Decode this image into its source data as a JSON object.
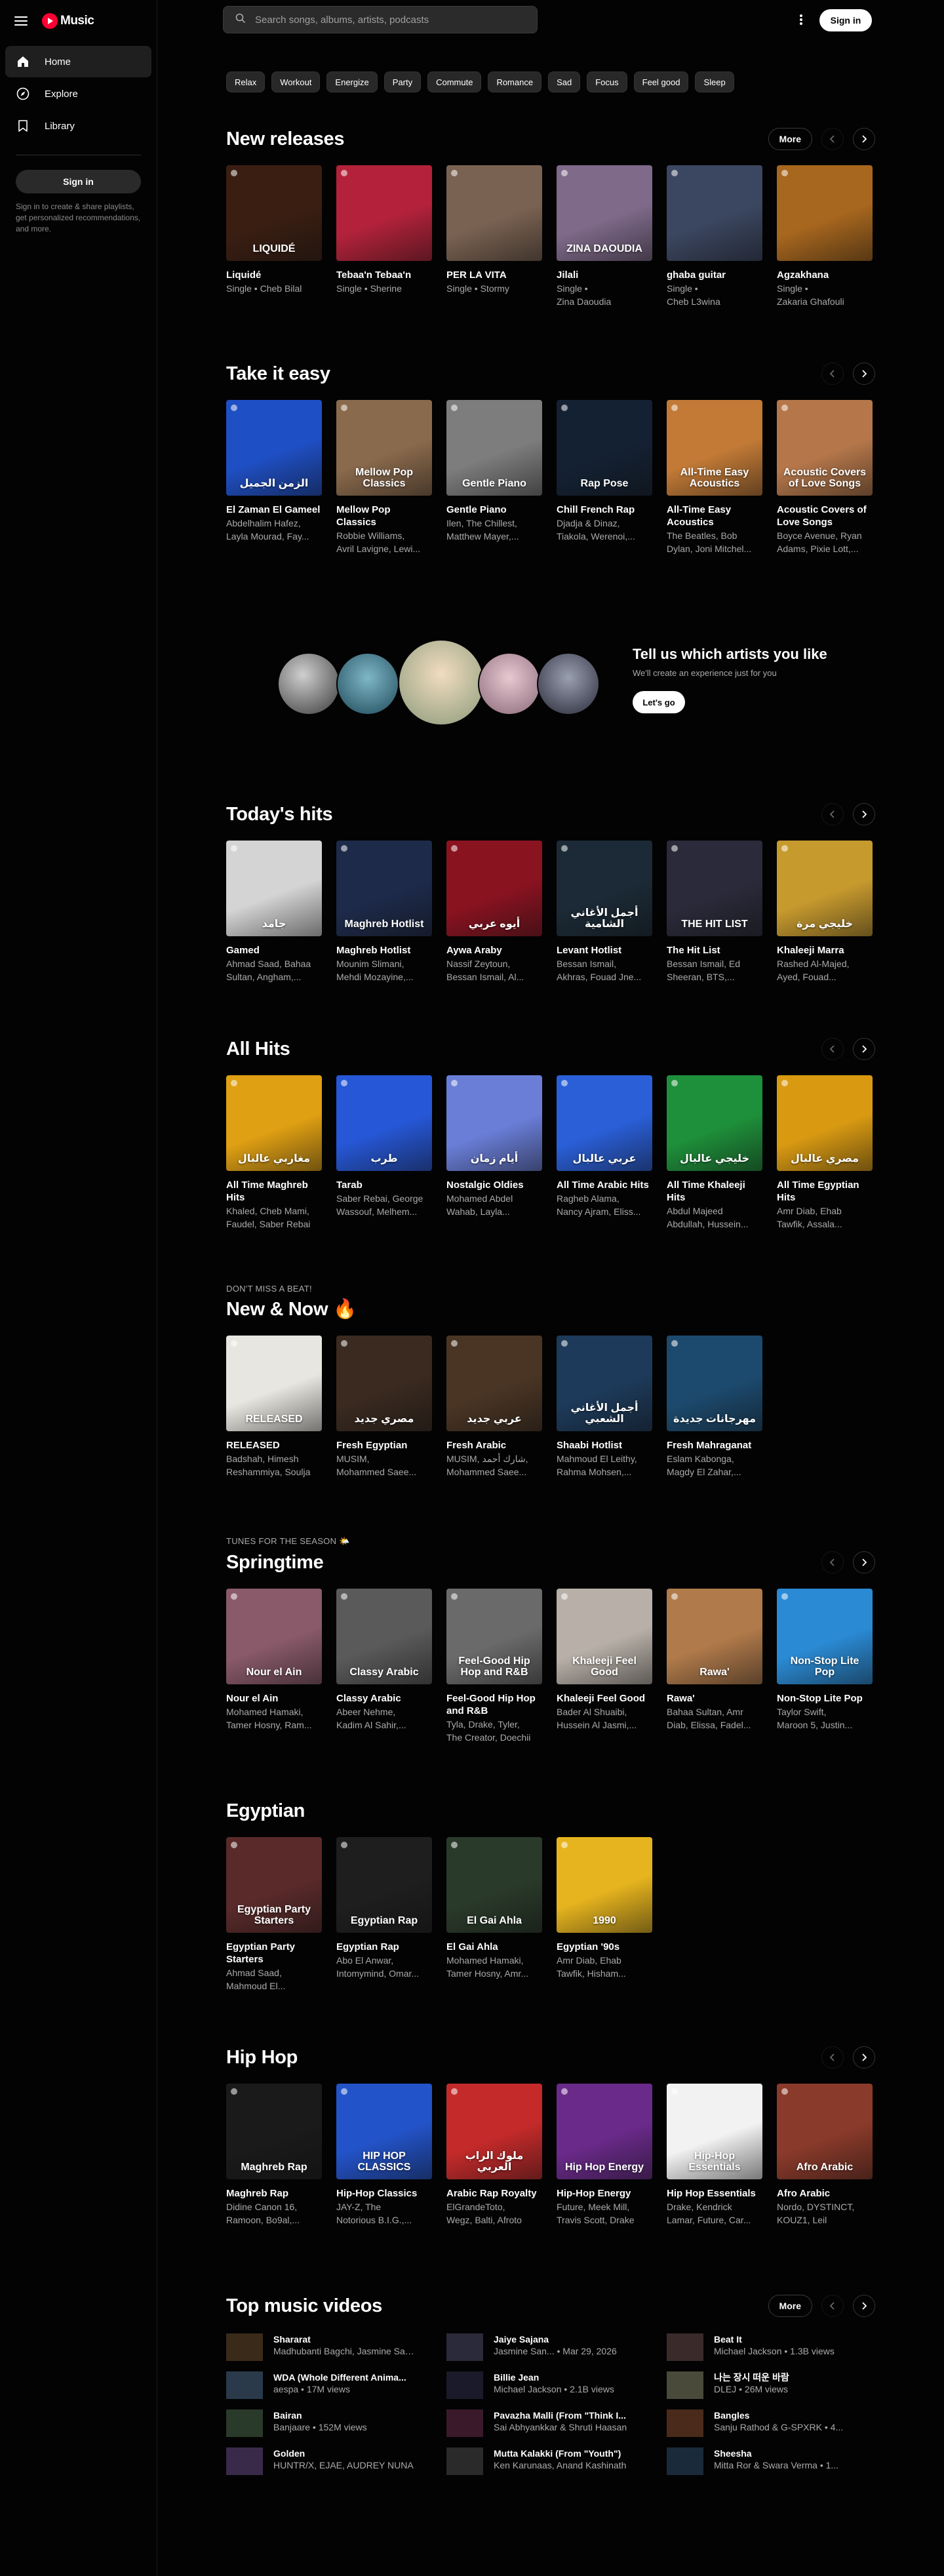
{
  "app": {
    "logo_text": "Music",
    "accent": "#ff0033"
  },
  "sidebar": {
    "items": [
      {
        "label": "Home",
        "icon": "home-icon"
      },
      {
        "label": "Explore",
        "icon": "compass-icon"
      },
      {
        "label": "Library",
        "icon": "library-icon"
      }
    ],
    "sign_in_label": "Sign in",
    "note": "Sign in to create & share playlists, get personalized recommendations, and more."
  },
  "topbar": {
    "search_placeholder": "Search songs, albums, artists, podcasts",
    "sign_in_label": "Sign in"
  },
  "chips": [
    "Relax",
    "Workout",
    "Energize",
    "Party",
    "Commute",
    "Romance",
    "Sad",
    "Focus",
    "Feel good",
    "Sleep"
  ],
  "controls": {
    "more_label": "More"
  },
  "new_releases": {
    "title": "New releases",
    "cards": [
      {
        "title": "Liquidé",
        "sub1": "Single • Cheb Bilal",
        "sub2": "",
        "art": "LIQUIDÉ",
        "bg": "#3a1e12"
      },
      {
        "title": "Tebaa'n Tebaa'n",
        "sub1": "Single • Sherine",
        "sub2": "",
        "art": "",
        "bg": "#b3223a"
      },
      {
        "title": "PER LA VITA",
        "sub1": "Single • Stormy",
        "sub2": "",
        "art": "",
        "bg": "#7a6252"
      },
      {
        "title": "Jilali",
        "sub1": "Single •",
        "sub2": "Zina Daoudia",
        "art": "ZINA DAOUDIA",
        "bg": "#7f6a8a"
      },
      {
        "title": "ghaba guitar",
        "sub1": "Single •",
        "sub2": "Cheb L3wina",
        "art": "",
        "bg": "#3b4660"
      },
      {
        "title": "Agzakhana",
        "sub1": "Single •",
        "sub2": "Zakaria Ghafouli",
        "art": "",
        "bg": "#a8671e"
      }
    ]
  },
  "take_it_easy": {
    "title": "Take it easy",
    "cards": [
      {
        "title": "El Zaman El Gameel",
        "sub1": "Abdelhalim Hafez,",
        "sub2": "Layla Mourad, Fay...",
        "art": "الزمن الجميل",
        "bg": "#1f4fc4"
      },
      {
        "title": "Mellow Pop Classics",
        "sub1": "Robbie Williams,",
        "sub2": "Avril Lavigne, Lewi...",
        "art": "Mellow Pop Classics",
        "bg": "#8a6a4c"
      },
      {
        "title": "Gentle Piano",
        "sub1": "Ilen, The Chillest,",
        "sub2": "Matthew Mayer,...",
        "art": "Gentle Piano",
        "bg": "#7d7d7d"
      },
      {
        "title": "Chill French Rap",
        "sub1": "Djadja & Dinaz,",
        "sub2": "Tiakola, Werenoi,...",
        "art": "Rap Pose",
        "bg": "#142133"
      },
      {
        "title": "All-Time Easy Acoustics",
        "sub1": "The Beatles, Bob",
        "sub2": "Dylan, Joni Mitchel...",
        "art": "All-Time Easy Acoustics",
        "bg": "#c27a36"
      },
      {
        "title": "Acoustic Covers of Love Songs",
        "sub1": "Boyce Avenue, Ryan",
        "sub2": "Adams, Pixie Lott,...",
        "art": "Acoustic Covers of Love Songs",
        "bg": "#b5774a"
      }
    ]
  },
  "artists_prompt": {
    "title": "Tell us which artists you like",
    "sub": "We'll create an experience just for you",
    "cta": "Let's go"
  },
  "todays_hits": {
    "title": "Today's hits",
    "cards": [
      {
        "title": "Gamed",
        "sub1": "Ahmad Saad, Bahaa",
        "sub2": "Sultan, Angham,...",
        "art": "جامد",
        "bg": "#d4d4d4"
      },
      {
        "title": "Maghreb Hotlist",
        "sub1": "Mounim Slimani,",
        "sub2": "Mehdi Mozayine,...",
        "art": "Maghreb Hotlist",
        "bg": "#1d2a4a"
      },
      {
        "title": "Aywa Araby",
        "sub1": "Nassif Zeytoun,",
        "sub2": "Bessan Ismail, Al...",
        "art": "أيوه عربي",
        "bg": "#8a1320"
      },
      {
        "title": "Levant Hotlist",
        "sub1": "Bessan Ismail,",
        "sub2": "Akhras, Fouad Jne...",
        "art": "أجمل الأغاني الشامية",
        "bg": "#1b2a36"
      },
      {
        "title": "The Hit List",
        "sub1": "Bessan Ismail, Ed",
        "sub2": "Sheeran, BTS,...",
        "art": "THE HIT LIST",
        "bg": "#2a2a3a"
      },
      {
        "title": "Khaleeji Marra",
        "sub1": "Rashed Al-Majed,",
        "sub2": "Ayed, Fouad...",
        "art": "خليجي مرة",
        "bg": "#c79a2e"
      }
    ]
  },
  "all_hits": {
    "title": "All Hits",
    "cards": [
      {
        "title": "All Time Maghreb Hits",
        "sub1": "Khaled, Cheb Mami,",
        "sub2": "Faudel, Saber Rebai",
        "art": "مغاربي عالبال",
        "bg": "#e0a013"
      },
      {
        "title": "Tarab",
        "sub1": "Saber Rebai, George",
        "sub2": "Wassouf, Melhem...",
        "art": "طرب",
        "bg": "#2657d6"
      },
      {
        "title": "Nostalgic Oldies",
        "sub1": "Mohamed Abdel",
        "sub2": "Wahab, Layla...",
        "art": "أيام زمان",
        "bg": "#6a7ed8"
      },
      {
        "title": "All Time Arabic Hits",
        "sub1": "Ragheb Alama,",
        "sub2": "Nancy Ajram, Eliss...",
        "art": "عربي عالبال",
        "bg": "#2a5fd8"
      },
      {
        "title": "All Time Khaleeji Hits",
        "sub1": "Abdul Majeed",
        "sub2": "Abdullah, Hussein...",
        "art": "خليجي عالبال",
        "bg": "#1e8f3a"
      },
      {
        "title": "All Time Egyptian Hits",
        "sub1": "Amr Diab, Ehab",
        "sub2": "Tawfik, Assala...",
        "art": "مصري عالبال",
        "bg": "#d99a12"
      }
    ]
  },
  "new_now": {
    "sub": "DON'T MISS A BEAT!",
    "title": "New & Now 🔥",
    "cards": [
      {
        "title": "RELEASED",
        "sub1": "Badshah, Himesh",
        "sub2": "Reshammiya, Soulja",
        "art": "RELEASED",
        "bg": "#e8e6e0"
      },
      {
        "title": "Fresh Egyptian",
        "sub1": "MUSIM,",
        "sub2": "Mohammed Saee...",
        "art": "مصري جديد",
        "bg": "#3a2a20"
      },
      {
        "title": "Fresh Arabic",
        "sub1": "MUSIM, شارك أحمد,",
        "sub2": "Mohammed Saee...",
        "art": "عربي جديد",
        "bg": "#4a3524"
      },
      {
        "title": "Shaabi Hotlist",
        "sub1": "Mahmoud El Leithy,",
        "sub2": "Rahma Mohsen,...",
        "art": "أجمل الأغاني الشعبي",
        "bg": "#1d3a5a"
      },
      {
        "title": "Fresh Mahraganat",
        "sub1": "Eslam Kabonga,",
        "sub2": "Magdy El Zahar,...",
        "art": "مهرجانات جديدة",
        "bg": "#1c4a6e"
      }
    ]
  },
  "springtime": {
    "sub": "TUNES FOR THE SEASON 🌤️",
    "title": "Springtime",
    "cards": [
      {
        "title": "Nour el Ain",
        "sub1": "Mohamed Hamaki,",
        "sub2": "Tamer Hosny, Ram...",
        "art": "Nour el Ain",
        "bg": "#8a5a6a"
      },
      {
        "title": "Classy Arabic",
        "sub1": "Abeer Nehme,",
        "sub2": "Kadim Al Sahir,...",
        "art": "Classy Arabic",
        "bg": "#5a5a5a"
      },
      {
        "title": "Feel-Good Hip Hop and R&B",
        "sub1": "Tyla, Drake, Tyler,",
        "sub2": "The Creator, Doechii",
        "art": "Feel-Good Hip Hop and R&B",
        "bg": "#6a6a6a"
      },
      {
        "title": "Khaleeji Feel Good",
        "sub1": "Bader Al Shuaibi,",
        "sub2": "Hussein Al Jasmi,...",
        "art": "Khaleeji Feel Good",
        "bg": "#b8b0a8"
      },
      {
        "title": "Rawa'",
        "sub1": "Bahaa Sultan, Amr",
        "sub2": "Diab, Elissa, Fadel...",
        "art": "Rawa'",
        "bg": "#b07a4a"
      },
      {
        "title": "Non-Stop Lite Pop",
        "sub1": "Taylor Swift,",
        "sub2": "Maroon 5, Justin...",
        "art": "Non-Stop Lite Pop",
        "bg": "#2a8ad4"
      }
    ]
  },
  "egyptian": {
    "title": "Egyptian",
    "cards": [
      {
        "title": "Egyptian Party Starters",
        "sub1": "Ahmad Saad,",
        "sub2": "Mahmoud El...",
        "art": "Egyptian Party Starters",
        "bg": "#5a2a2a"
      },
      {
        "title": "Egyptian Rap",
        "sub1": "Abo El Anwar,",
        "sub2": "Intomymind, Omar...",
        "art": "Egyptian Rap",
        "bg": "#1e1e1e"
      },
      {
        "title": "El Gai Ahla",
        "sub1": "Mohamed Hamaki,",
        "sub2": "Tamer Hosny, Amr...",
        "art": "El Gai Ahla",
        "bg": "#2a3a2a"
      },
      {
        "title": "Egyptian '90s",
        "sub1": "Amr Diab, Ehab",
        "sub2": "Tawfik, Hisham...",
        "art": "1990",
        "bg": "#e6b41e"
      }
    ]
  },
  "hip_hop": {
    "title": "Hip Hop",
    "cards": [
      {
        "title": "Maghreb Rap",
        "sub1": "Didine Canon 16,",
        "sub2": "Ramoon, Bo9al,...",
        "art": "Maghreb Rap",
        "bg": "#1a1a1a"
      },
      {
        "title": "Hip-Hop Classics",
        "sub1": "JAY-Z, The",
        "sub2": "Notorious B.I.G.,...",
        "art": "HIP HOP CLASSICS",
        "bg": "#2353c8"
      },
      {
        "title": "Arabic Rap Royalty",
        "sub1": "ElGrandeToto,",
        "sub2": "Wegz, Balti, Afroto",
        "art": "ملوك الراب العربي",
        "bg": "#c42a2a"
      },
      {
        "title": "Hip-Hop Energy",
        "sub1": "Future, Meek Mill,",
        "sub2": "Travis Scott, Drake",
        "art": "Hip Hop Energy",
        "bg": "#6a2a8a"
      },
      {
        "title": "Hip Hop Essentials",
        "sub1": "Drake, Kendrick",
        "sub2": "Lamar, Future, Car...",
        "art": "Hip-Hop Essentials",
        "bg": "#f2f2f2"
      },
      {
        "title": "Afro Arabic",
        "sub1": "Nordo, DYSTINCT,",
        "sub2": "KOUZ1, Leil",
        "art": "Afro Arabic",
        "bg": "#8a3a2a"
      }
    ]
  },
  "top_videos": {
    "title": "Top music videos",
    "items": [
      {
        "title": "Shararat",
        "sub": "Madhubanti Bagchi, Jasmine Sandlas",
        "bg": "#3a2a1a"
      },
      {
        "title": "Jaiye Sajana",
        "sub": "Jasmine San... • Mar 29, 2026",
        "bg": "#2a2a3a"
      },
      {
        "title": "Beat It",
        "sub": "Michael Jackson • 1.3B views",
        "bg": "#3a2a2a"
      },
      {
        "title": "WDA (Whole Different Anima...",
        "sub": "aespa • 17M views",
        "bg": "#2a3a4a"
      },
      {
        "title": "Billie Jean",
        "sub": "Michael Jackson • 2.1B views",
        "bg": "#1a1a2a"
      },
      {
        "title": "나는 장시 떠운 바람",
        "sub": "DLEJ • 26M views",
        "bg": "#4a4a3a"
      },
      {
        "title": "Bairan",
        "sub": "Banjaare • 152M views",
        "bg": "#2a3a2a"
      },
      {
        "title": "Pavazha Malli (From \"Think I...",
        "sub": "Sai Abhyankkar & Shruti Haasan",
        "bg": "#3a1a2a"
      },
      {
        "title": "Bangles",
        "sub": "Sanju Rathod & G-SPXRK • 4...",
        "bg": "#4a2a1a"
      },
      {
        "title": "Golden",
        "sub": "HUNTR/X, EJAE, AUDREY NUNA",
        "bg": "#3a2a4a"
      },
      {
        "title": "Mutta Kalakki (From \"Youth\")",
        "sub": "Ken Karunaas, Anand Kashinath",
        "bg": "#2a2a2a"
      },
      {
        "title": "Sheesha",
        "sub": "Mitta Ror & Swara Verma • 1...",
        "bg": "#1a2a3a"
      }
    ]
  }
}
